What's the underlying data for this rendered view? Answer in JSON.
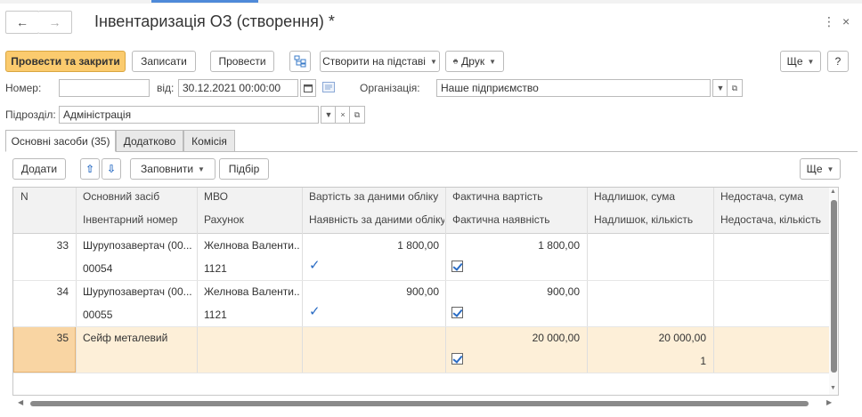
{
  "title": "Інвентаризація ОЗ (створення) *",
  "window": {
    "more": "⋮",
    "close": "×"
  },
  "toolbar": {
    "post_close": "Провести та закрити",
    "save": "Записати",
    "post": "Провести",
    "create_based": "Створити на підставі",
    "print": "Друк",
    "more": "Ще",
    "help": "?"
  },
  "form": {
    "number_label": "Номер:",
    "number_value": "",
    "date_label": "від:",
    "date_value": "30.12.2021 00:00:00",
    "org_label": "Організація:",
    "org_value": "Наше підприємство",
    "dept_label": "Підрозділ:",
    "dept_value": "Адміністрація"
  },
  "tabs": [
    "Основні засоби (35)",
    "Додатково",
    "Комісія"
  ],
  "table_toolbar": {
    "add": "Додати",
    "fill": "Заповнити",
    "select": "Підбір",
    "more": "Ще"
  },
  "table": {
    "header_top": [
      "N",
      "Основний засіб",
      "МВО",
      "Вартість за даними обліку",
      "Фактична вартість",
      "Надлишок, сума",
      "Недостача, сума"
    ],
    "header_bottom": [
      "",
      "Інвентарний номер",
      "Рахунок",
      "Наявність за даними обліку",
      "Фактична наявність",
      "Надлишок, кількість",
      "Недостача, кількість"
    ],
    "rows": [
      {
        "n": "33",
        "asset": "Шурупозавертач (00...",
        "mvo": "Желнова Валенти...",
        "book_value": "1 800,00",
        "actual_value": "1 800,00",
        "surplus_sum": "",
        "shortage_sum": "",
        "inv_no": "00054",
        "account": "1121",
        "book_presence": true,
        "actual_presence": true,
        "surplus_qty": "",
        "shortage_qty": ""
      },
      {
        "n": "34",
        "asset": "Шурупозавертач (00...",
        "mvo": "Желнова Валенти...",
        "book_value": "900,00",
        "actual_value": "900,00",
        "surplus_sum": "",
        "shortage_sum": "",
        "inv_no": "00055",
        "account": "1121",
        "book_presence": true,
        "actual_presence": true,
        "surplus_qty": "",
        "shortage_qty": ""
      },
      {
        "n": "35",
        "asset": "Сейф металевий",
        "mvo": "",
        "book_value": "",
        "actual_value": "20 000,00",
        "surplus_sum": "20 000,00",
        "shortage_sum": "",
        "inv_no": "",
        "account": "",
        "book_presence": false,
        "actual_presence": true,
        "surplus_qty": "1",
        "shortage_qty": ""
      }
    ]
  },
  "colors": {
    "primary_button": "#fbcb6e",
    "selected_row": "#fdefd8",
    "current_cell": "#f9d5a3",
    "check": "#2a6cc4"
  }
}
